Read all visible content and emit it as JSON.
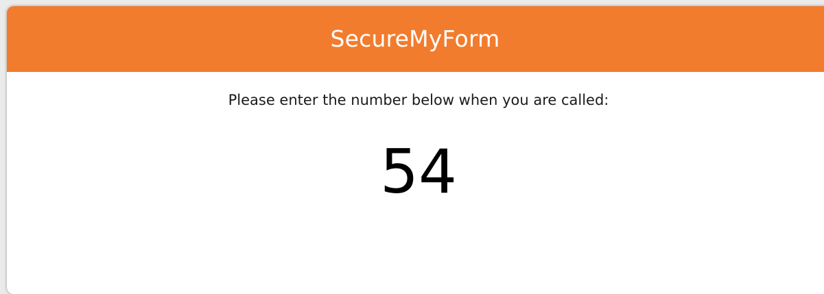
{
  "header": {
    "title": "SecureMyForm"
  },
  "main": {
    "instruction": "Please enter the number below when you are called:",
    "number": "54"
  },
  "colors": {
    "header_bg": "#f27c2e",
    "header_text": "#ffffff",
    "body_bg": "#ffffff"
  }
}
